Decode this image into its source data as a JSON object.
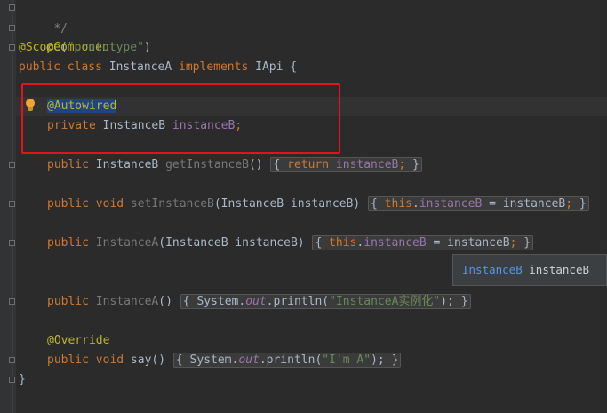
{
  "editor": {
    "comment_end": "*/",
    "annotation_component": "@Component",
    "annotation_scope": "@Scope",
    "scope_paren_open": "(",
    "scope_value": "\"prototype\"",
    "scope_paren_close": ")",
    "class_kw": "public class",
    "class_name": " InstanceA ",
    "implements_kw": "implements",
    "interface_name": " IApi {",
    "autowired": "@Autowired",
    "field_kw": "private",
    "field_type": " InstanceB ",
    "field_name": "instanceB",
    "semicolon": ";",
    "getter": {
      "kw": "public",
      "type": " InstanceB ",
      "name": "getInstanceB",
      "parens": "()",
      "open": "{",
      "return_kw": "return",
      "field": "instanceB",
      "semi": ";",
      "close": "}"
    },
    "setter": {
      "kw": "public void",
      "name": "setInstanceB",
      "params": "(InstanceB instanceB)",
      "open": "{",
      "this_kw": "this",
      "dot": ".",
      "field": "instanceB",
      "assign": " = instanceB",
      "semi": ";",
      "close": "}"
    },
    "ctor1": {
      "kw": "public",
      "name": "InstanceA",
      "params": "(InstanceB instanceB)",
      "open": "{",
      "this_kw": "this",
      "dot": ".",
      "field": "instanceB",
      "assign": " = instanceB",
      "semi": ";",
      "close": "}"
    },
    "ctor2": {
      "kw": "public",
      "name": "InstanceA",
      "parens": "()",
      "open": "{",
      "system": "System.",
      "out": "out",
      "println": ".println(",
      "str": "\"InstanceA实例化\"",
      "end": ");",
      "close": "}"
    },
    "override": "@Override",
    "say": {
      "kw": "public void",
      "name": " say",
      "parens": "()",
      "open": "{",
      "system": "System.",
      "out": "out",
      "println": ".println(",
      "str": "\"I'm A\"",
      "end": ");",
      "close": "}"
    },
    "class_close": "}"
  },
  "tooltip": {
    "type": "InstanceB",
    "name": "instanceB"
  },
  "colors": {
    "background": "#2b2b2b",
    "keyword": "#cc7832",
    "annotation": "#bbb529",
    "string": "#6a8759",
    "field": "#9876aa",
    "highlight_box": "#e0141d"
  }
}
